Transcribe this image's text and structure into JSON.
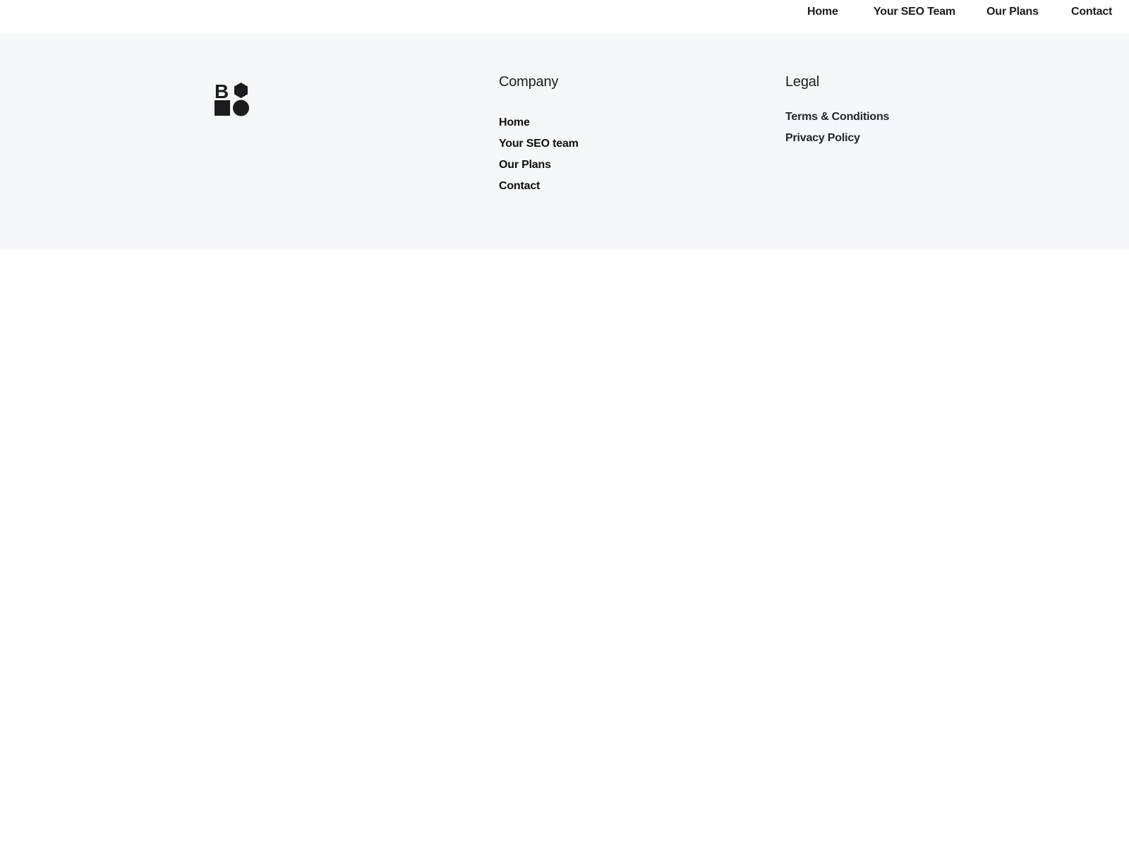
{
  "topnav": {
    "items": [
      {
        "label": "Home"
      },
      {
        "label": "Your SEO Team"
      },
      {
        "label": "Our Plans"
      },
      {
        "label": "Contact"
      }
    ]
  },
  "footer": {
    "logo": {
      "letter": "B",
      "icon": "brand-logo-icon"
    },
    "company": {
      "heading": "Company",
      "links": [
        {
          "label": "Home"
        },
        {
          "label": "Your SEO team"
        },
        {
          "label": "Our Plans"
        },
        {
          "label": "Contact"
        }
      ]
    },
    "legal": {
      "heading": "Legal",
      "links": [
        {
          "label": "Terms & Conditions"
        },
        {
          "label": "Privacy Policy"
        }
      ]
    }
  },
  "colors": {
    "text": "#1b1b20",
    "footer_bg": "#f6f7fb",
    "page_bg": "#ffffff"
  }
}
